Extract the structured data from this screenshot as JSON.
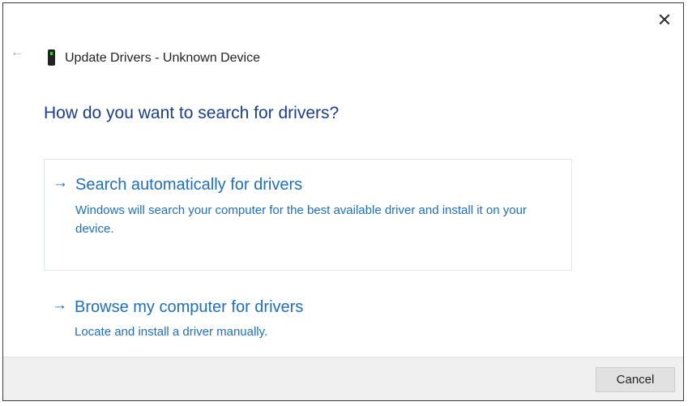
{
  "window": {
    "title": "Update Drivers - Unknown Device",
    "close_icon": "close-icon",
    "back_icon": "back-arrow-icon",
    "device_icon": "device-icon"
  },
  "heading": "How do you want to search for drivers?",
  "options": [
    {
      "title": "Search automatically for drivers",
      "description": "Windows will search your computer for the best available driver and install it on your device."
    },
    {
      "title": "Browse my computer for drivers",
      "description": "Locate and install a driver manually."
    }
  ],
  "arrow_glyph": "→",
  "footer": {
    "cancel_label": "Cancel"
  },
  "colors": {
    "accent": "#1e6fc1",
    "heading": "#1a3e8c"
  }
}
